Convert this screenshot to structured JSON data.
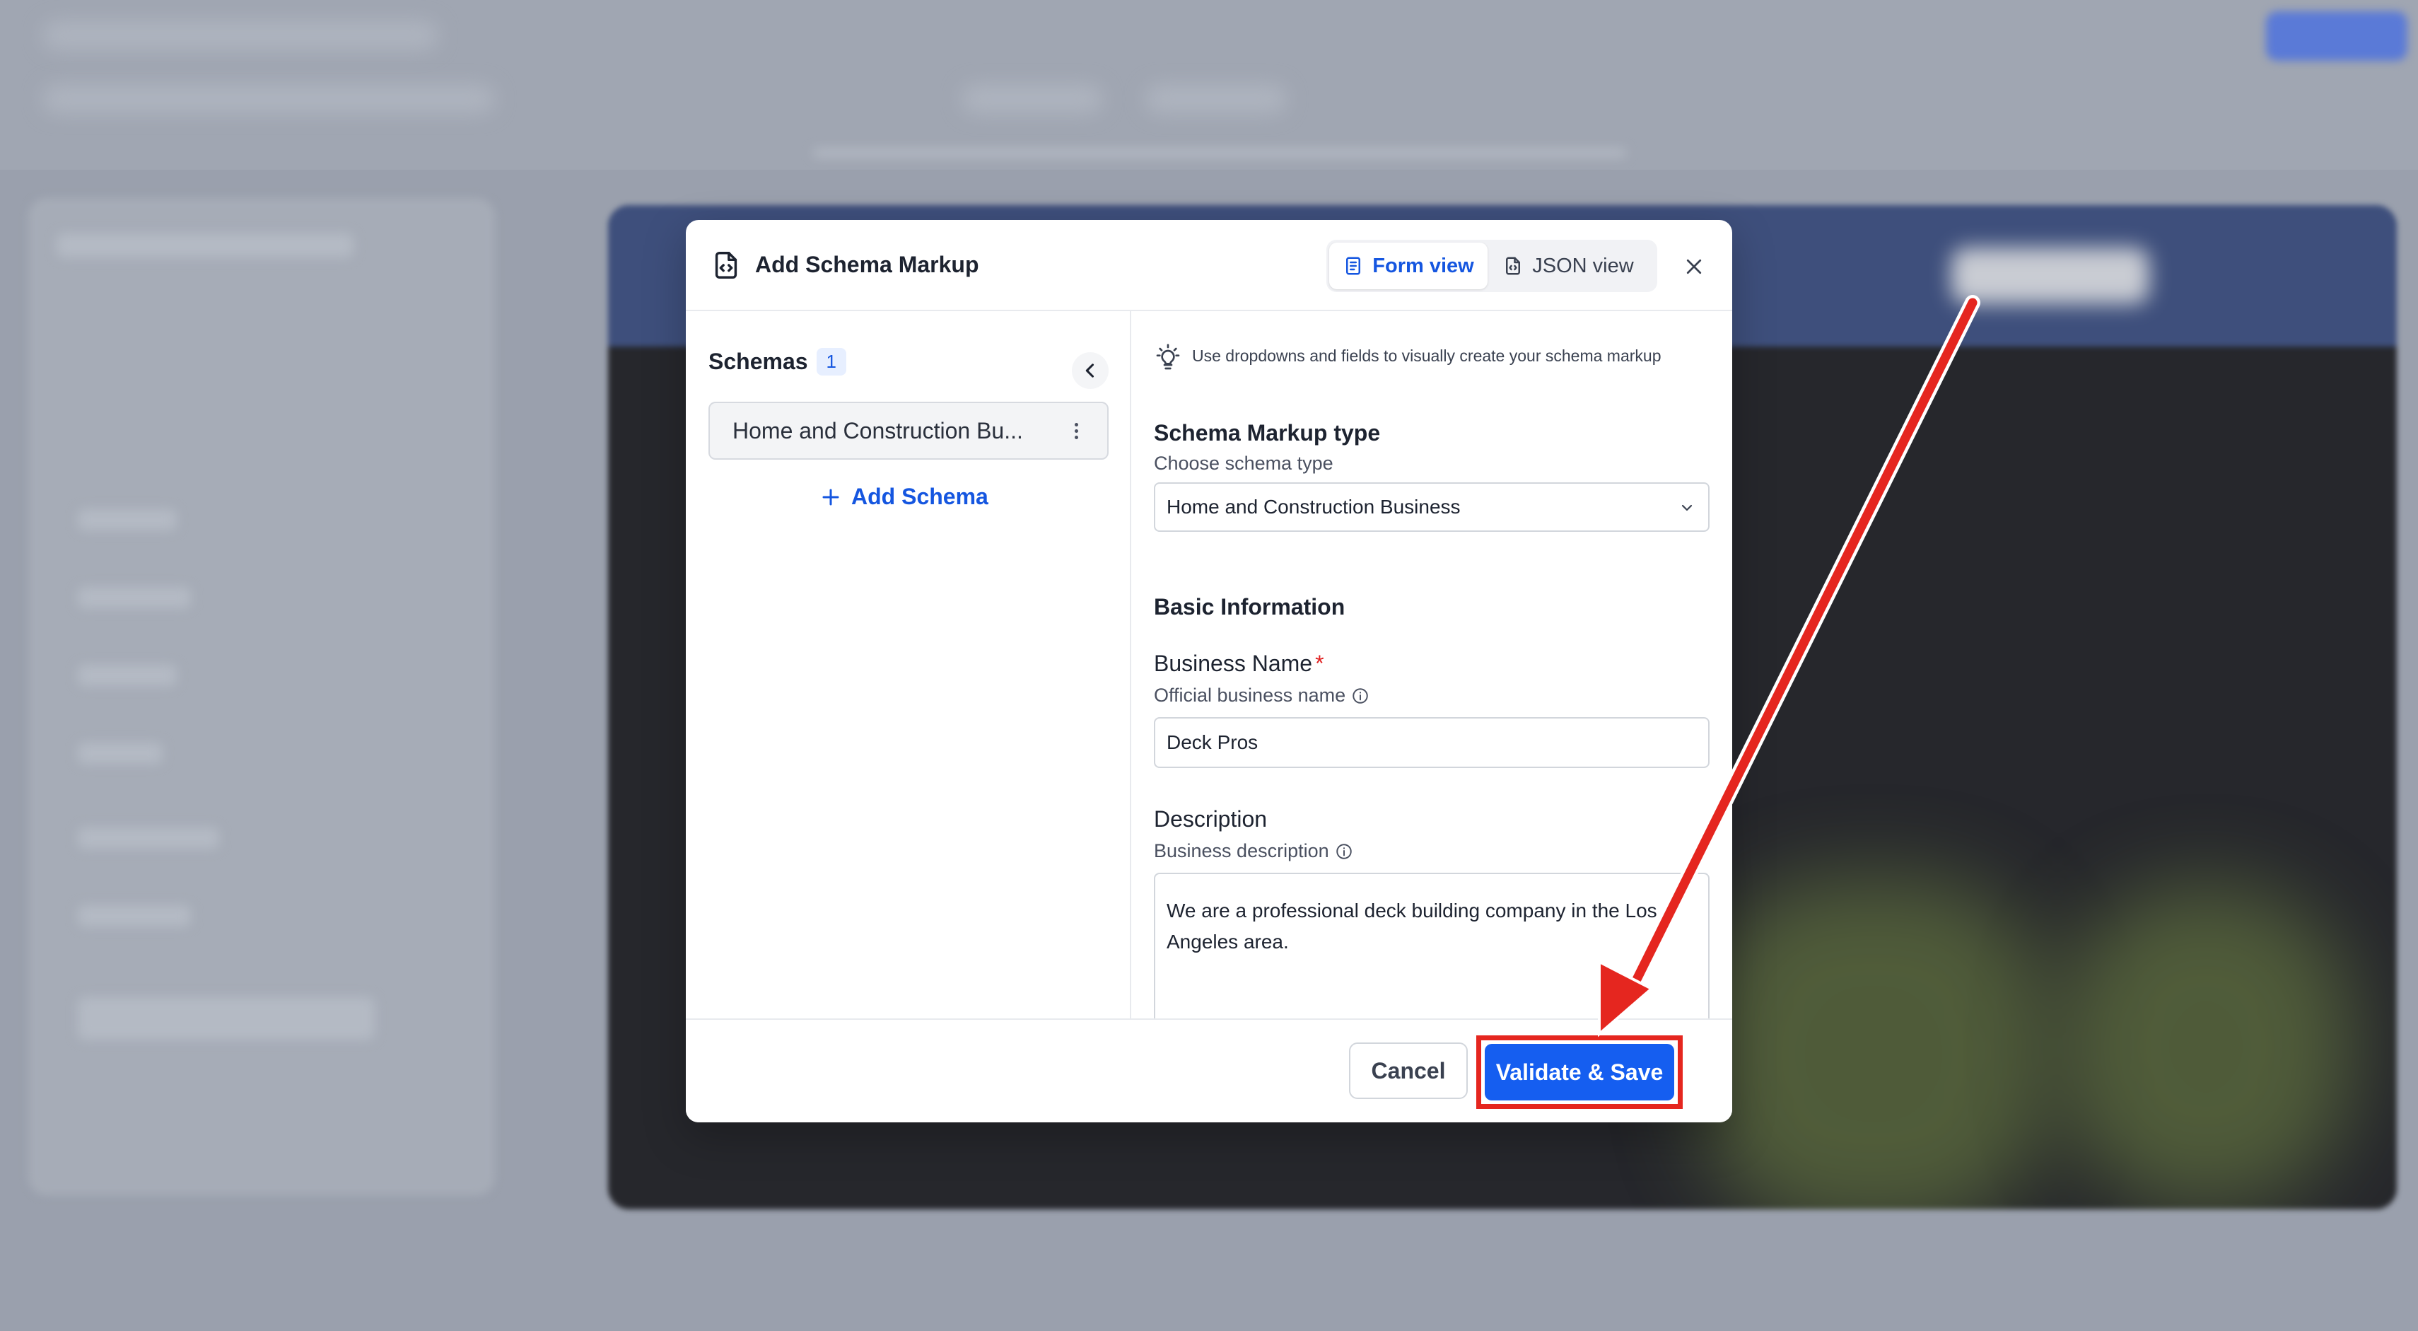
{
  "modal": {
    "title": "Add Schema Markup",
    "views": [
      {
        "label": "Form view",
        "active": true
      },
      {
        "label": "JSON view",
        "active": false
      }
    ]
  },
  "sidebar": {
    "heading": "Schemas",
    "count": "1",
    "items": [
      {
        "label": "Home and Construction Bu..."
      }
    ],
    "add_label": "Add Schema"
  },
  "form": {
    "hint": "Use dropdowns and fields to visually create your schema markup",
    "markup_type": {
      "title": "Schema Markup type",
      "subtitle": "Choose schema type",
      "selected": "Home and Construction Business"
    },
    "basic_info_title": "Basic Information",
    "business_name": {
      "label": "Business Name",
      "required_mark": "*",
      "subtitle": "Official business name",
      "value": "Deck Pros"
    },
    "description": {
      "label": "Description",
      "subtitle": "Business description",
      "value": "We are a professional deck building company in the Los Angeles area."
    }
  },
  "footer": {
    "cancel_label": "Cancel",
    "save_label": "Validate & Save"
  },
  "colors": {
    "accent": "#155ef0",
    "annotation": "#e5261f"
  }
}
